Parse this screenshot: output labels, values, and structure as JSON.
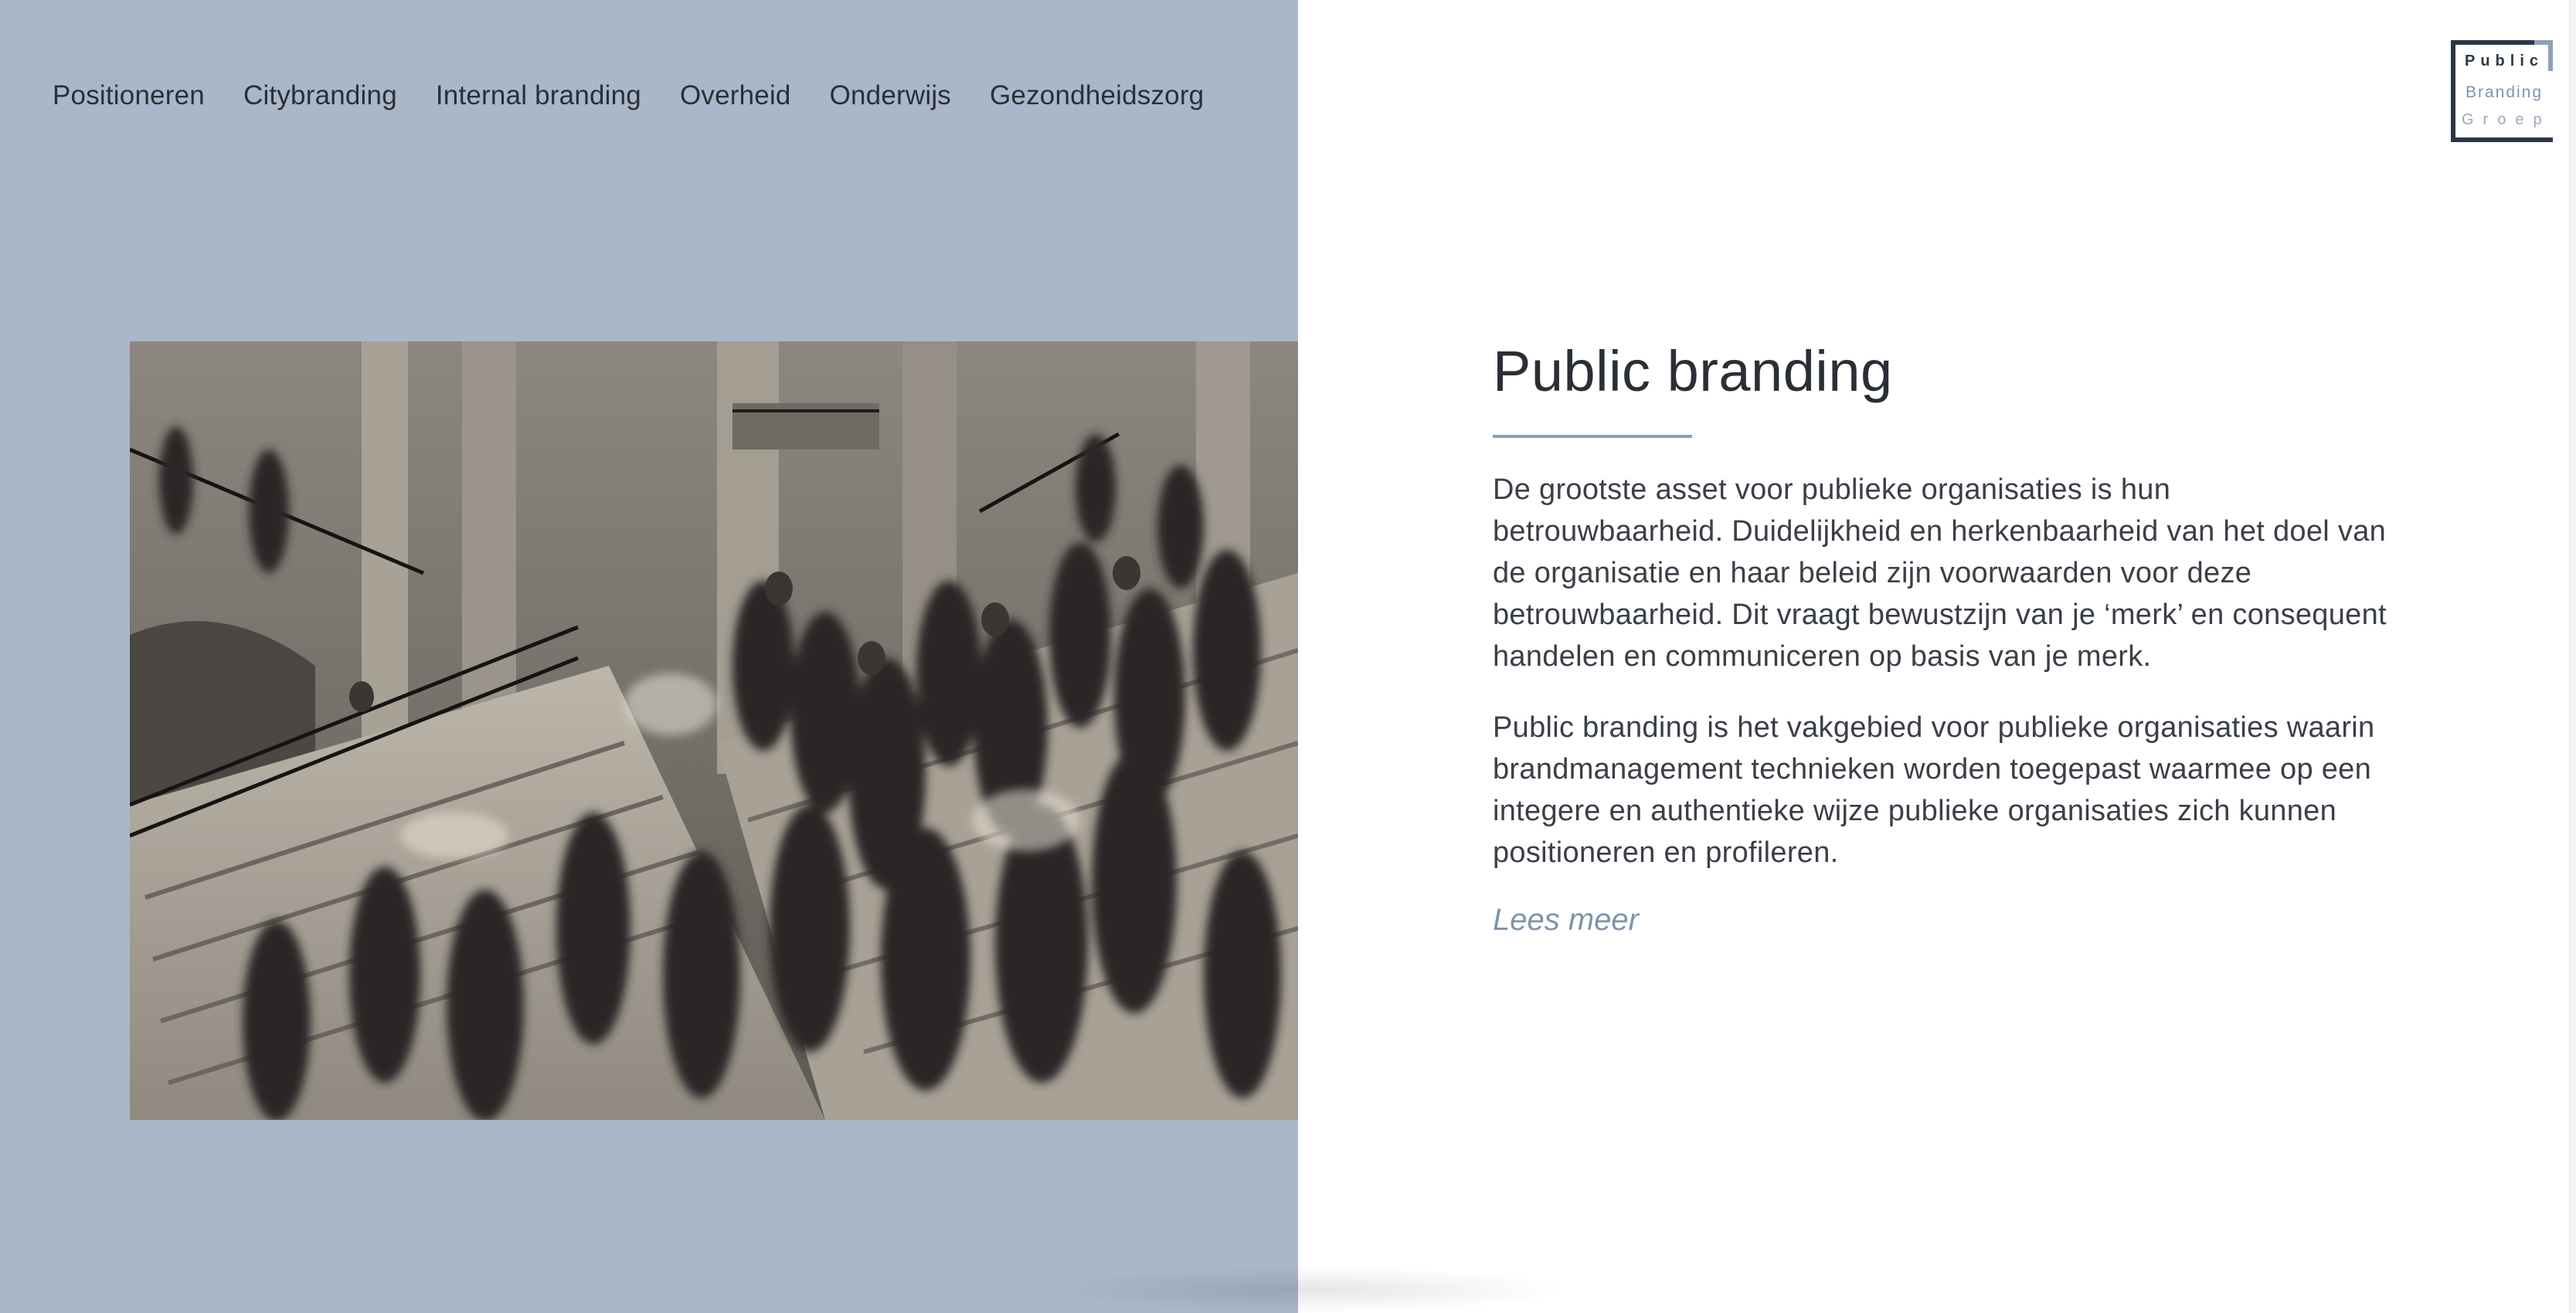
{
  "nav": {
    "items": [
      {
        "label": "Positioneren"
      },
      {
        "label": "Citybranding"
      },
      {
        "label": "Internal branding"
      },
      {
        "label": "Overheid"
      },
      {
        "label": "Onderwijs"
      },
      {
        "label": "Gezondheidszorg"
      }
    ]
  },
  "logo": {
    "line1": "Public",
    "line2": "Branding",
    "line3": "Groep"
  },
  "hero_image": {
    "subject": "crowd-on-stairs-photo"
  },
  "article": {
    "title": "Public branding",
    "paragraphs": [
      "De grootste asset voor publieke organisaties is hun betrouwbaarheid. Duidelijkheid en herkenbaarheid van het doel van de organisatie en haar beleid zijn voorwaarden voor deze betrouwbaarheid. Dit vraagt bewustzijn van je ‘merk’ en consequent handelen en communiceren op basis van je merk.",
      "Public branding is het vakgebied voor publieke organisaties waarin brandmanagement technieken worden toegepast waarmee op een integere en authentieke wijze publieke organisaties zich kunnen positioneren en profileren."
    ],
    "read_more": "Lees meer"
  },
  "colors": {
    "panel_blue": "#aab7c8",
    "accent": "#7f93ad",
    "text_dark": "#2a2f36",
    "logo_dark": "#2c3848"
  }
}
